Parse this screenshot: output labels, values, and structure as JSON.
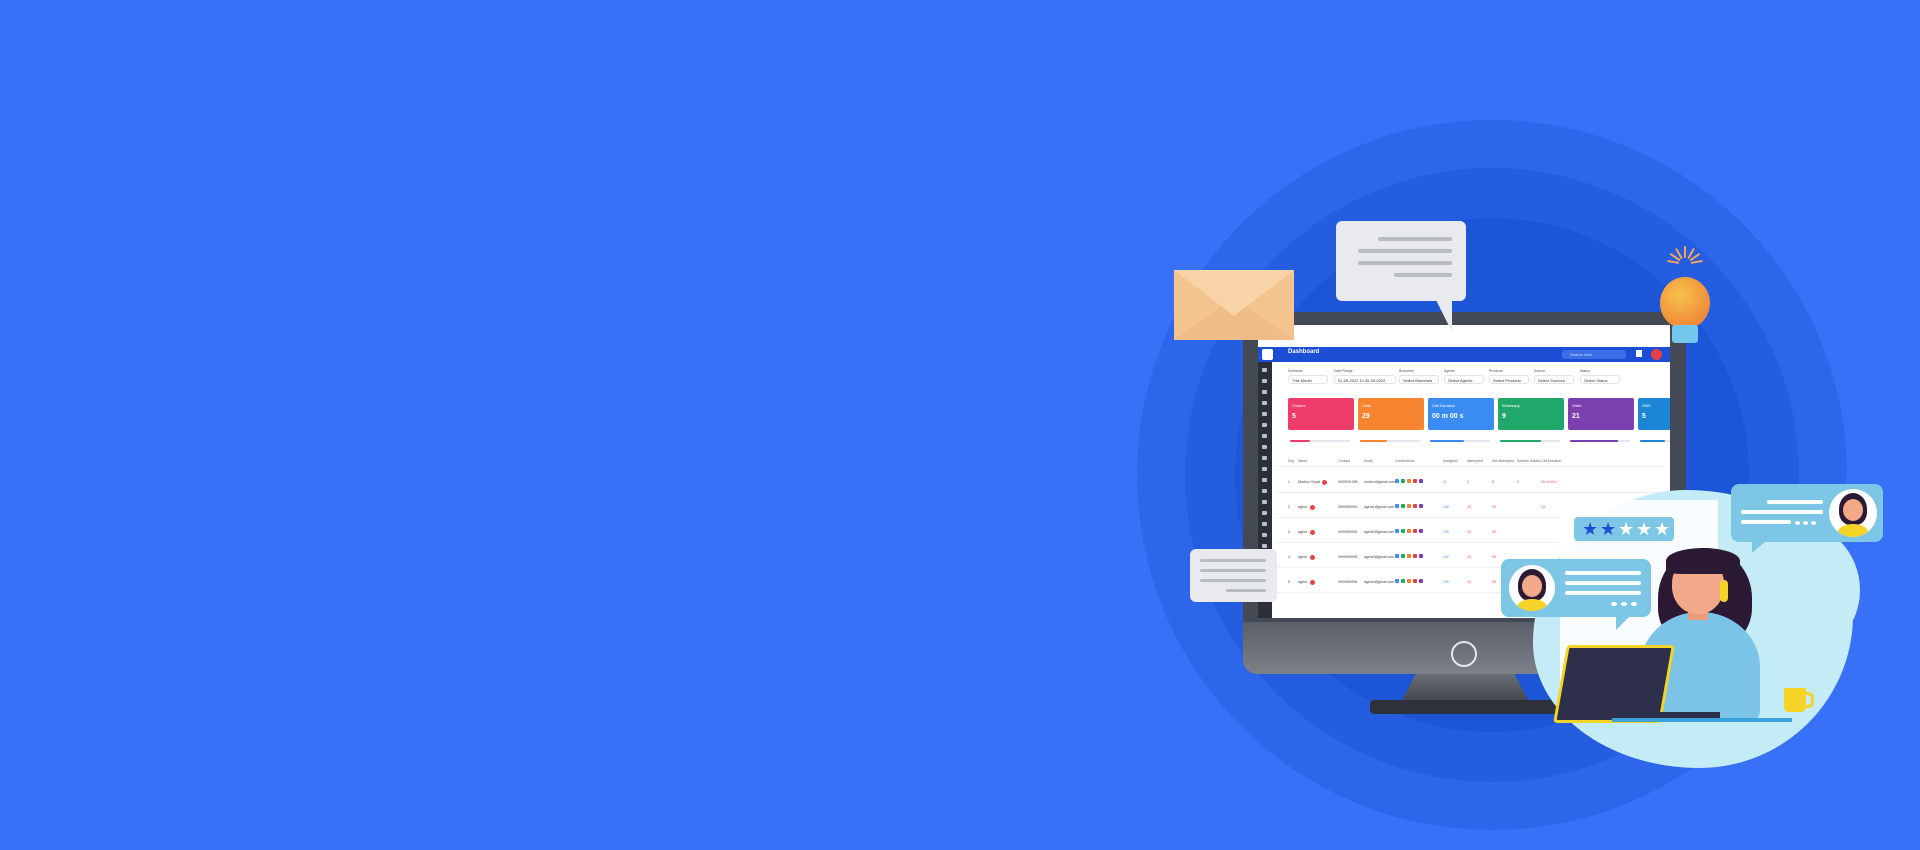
{
  "dashboard": {
    "title": "Dashboard",
    "search_placeholder": "Search Here",
    "filters": [
      {
        "label": "Schedule",
        "value": "This Month"
      },
      {
        "label": "Date Range",
        "value": "01-09-2022 To 30-09-2022"
      },
      {
        "label": "Branches",
        "value": "Select Branches"
      },
      {
        "label": "Agents",
        "value": "Select Agents"
      },
      {
        "label": "Products",
        "value": "Select Products"
      },
      {
        "label": "Source",
        "value": "Select Sources"
      },
      {
        "label": "Status",
        "value": "Select Status"
      }
    ],
    "cards": [
      {
        "label": "Closure",
        "value": "5",
        "color": "#ee3d6a"
      },
      {
        "label": "Calls",
        "value": "29",
        "color": "#f7842f"
      },
      {
        "label": "Call Duration",
        "value": "00 m 00 s",
        "color": "#3b8cf2"
      },
      {
        "label": "Whatsapp",
        "value": "9",
        "color": "#1fa86a"
      },
      {
        "label": "Visits",
        "value": "21",
        "color": "#7b3fb0"
      },
      {
        "label": "SMS",
        "value": "5",
        "color": "#1c86d6"
      }
    ],
    "table_headers": [
      "Seq",
      "Name",
      "Contact",
      "Email",
      "Connections",
      "Assigned",
      "Attempted",
      "Not Attempted",
      "Session Added",
      "Call Duration"
    ],
    "rows": [
      {
        "seq": "1",
        "name": "Madhur Goyal",
        "contact": "9999921999",
        "email": "madhur@gmail.com",
        "assigned": "11",
        "attempted": "3",
        "not_attempted": "8",
        "session": "0",
        "duration": "00 m 00 s"
      },
      {
        "seq": "2",
        "name": "agent",
        "contact": "9999999991",
        "email": "agent1@gmail.com",
        "assigned": "100",
        "attempted": "10",
        "not_attempted": "90",
        "session": "",
        "duration": "13"
      },
      {
        "seq": "3",
        "name": "agent",
        "contact": "9999999992",
        "email": "agent2@gmail.com",
        "assigned": "100",
        "attempted": "10",
        "not_attempted": "90",
        "session": "",
        "duration": ""
      },
      {
        "seq": "4",
        "name": "agent",
        "contact": "9999999993",
        "email": "agent3@gmail.com",
        "assigned": "100",
        "attempted": "10",
        "not_attempted": "90",
        "session": "",
        "duration": ""
      },
      {
        "seq": "5",
        "name": "agent",
        "contact": "9999999994",
        "email": "agent4@gmail.com",
        "assigned": "100",
        "attempted": "10",
        "not_attempted": "90",
        "session": "",
        "duration": ""
      }
    ]
  },
  "rating": {
    "filled": 2,
    "total": 5
  },
  "colors": {
    "background": "#3871f8",
    "accent_yellow": "#f5d327",
    "chat_blue": "#7dc6e6"
  },
  "icons": [
    "envelope-icon",
    "chat-bubble-icon",
    "lightbulb-icon",
    "star-icon",
    "avatar-icon"
  ]
}
